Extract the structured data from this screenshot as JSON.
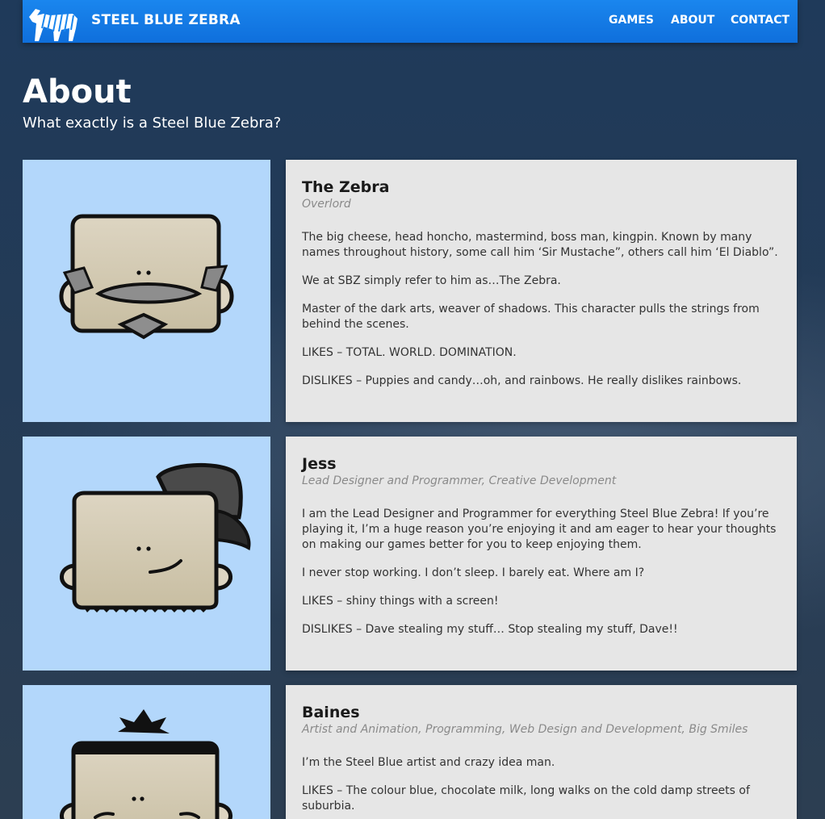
{
  "header": {
    "brand": "STEEL BLUE ZEBRA",
    "nav": [
      {
        "label": "GAMES"
      },
      {
        "label": "ABOUT"
      },
      {
        "label": "CONTACT"
      }
    ]
  },
  "page": {
    "title": "About",
    "subtitle": "What exactly is a Steel Blue Zebra?"
  },
  "members": [
    {
      "name": "The Zebra",
      "role": "Overlord",
      "paragraphs": [
        "The big cheese, head honcho, mastermind, boss man, kingpin. Known by many names throughout history, some call him ‘Sir Mustache”, others call him ‘El Diablo”.",
        "We at SBZ simply refer to him as…The Zebra.",
        "Master of the dark arts, weaver of shadows. This character pulls the strings from behind the scenes.",
        "LIKES – TOTAL. WORLD. DOMINATION.",
        "DISLIKES – Puppies and candy…oh, and rainbows. He really dislikes rainbows."
      ]
    },
    {
      "name": "Jess",
      "role": "Lead Designer and Programmer, Creative Development",
      "paragraphs": [
        "I am the Lead Designer and Programmer for everything Steel Blue Zebra! If you’re playing it, I’m a huge reason you’re enjoying it and am eager to hear your thoughts on making our games better for you to keep enjoying them.",
        "I never stop working. I don’t sleep. I barely eat. Where am I?",
        "LIKES – shiny things with a screen!",
        "DISLIKES – Dave stealing my stuff… Stop stealing my stuff, Dave!!"
      ]
    },
    {
      "name": "Baines",
      "role": "Artist and Animation, Programming, Web Design and Development, Big Smiles",
      "paragraphs": [
        "I’m the Steel Blue artist and crazy idea man.",
        "LIKES – The colour blue, chocolate milk, long walks on the cold damp streets of suburbia."
      ]
    }
  ]
}
